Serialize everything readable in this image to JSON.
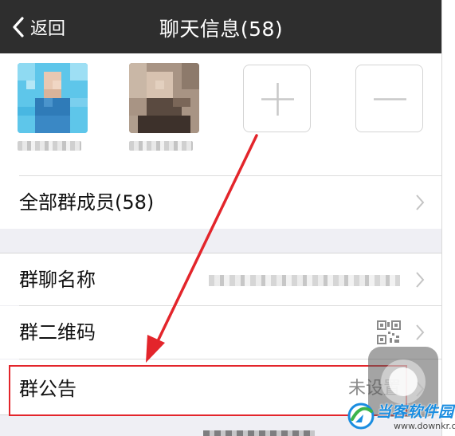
{
  "navbar": {
    "back_label": "返回",
    "title": "聊天信息(58)",
    "background": "#2e2e2e"
  },
  "members": {
    "items": [
      {
        "avatar": "blurred-avatar-blue",
        "name": ""
      },
      {
        "avatar": "blurred-avatar-photo",
        "name": ""
      }
    ],
    "add_icon": "plus-icon",
    "remove_icon": "minus-icon"
  },
  "all_members_row": {
    "label": "全部群成员(58)",
    "icon": "chevron-right-icon"
  },
  "settings": [
    {
      "label": "群聊名称",
      "value": "",
      "icon": "chevron-right-icon"
    },
    {
      "label": "群二维码",
      "value_icon": "qr-code-icon",
      "icon": "chevron-right-icon"
    },
    {
      "label": "群公告",
      "value": "未设置",
      "icon": "chevron-right-icon"
    }
  ],
  "watermark": {
    "brand": "当客软件园",
    "url": "www.downkr.com",
    "accent": "#1a8de0"
  },
  "annotation": {
    "highlight_color": "#e3252b"
  }
}
